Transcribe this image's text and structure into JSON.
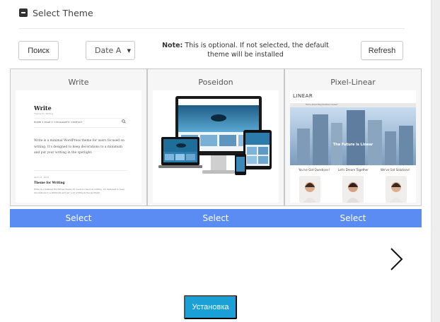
{
  "section": {
    "title": "Select Theme"
  },
  "toolbar": {
    "search_label": "Поиск",
    "sort_value": "Date A",
    "refresh_label": "Refresh",
    "note_prefix": "Note:",
    "note_text": " This is optional. If not selected, the default theme will be installed"
  },
  "themes": [
    {
      "name": "Write",
      "select_label": "Select",
      "preview": {
        "site_title": "Write",
        "tagline": "Theme for Writing",
        "menu": "HOME ▾   PAGE ▾   TYPOGRAPHY   CONTACT",
        "excerpt": "Write is a minimal WordPress theme for users focused on writing. It's designed to keep decorations to a minimum and put your writing in the spotlight.",
        "date": "April 21, 2015",
        "post_title": "Theme for Writing",
        "post_body": "Write is a minimal WordPress theme for users focused on writing. It's designed to keep decorations to a minimum and put your writing in the spotlight."
      }
    },
    {
      "name": "Poseidon",
      "select_label": "Select"
    },
    {
      "name": "Pixel-Linear",
      "select_label": "Select",
      "preview": {
        "logo": "LINEAR",
        "nav": "Home   About   Blog   Portfolio   Contact",
        "hero_text": "The Future is Linear",
        "heading_1": "You've Got Questions!",
        "heading_2": "Let's Dream Together",
        "heading_3": "We've Got Solutions!"
      }
    }
  ],
  "install": {
    "label": "Установка"
  },
  "colors": {
    "select_bar": "#5b8cf3",
    "install_button": "#1aa0d6"
  }
}
